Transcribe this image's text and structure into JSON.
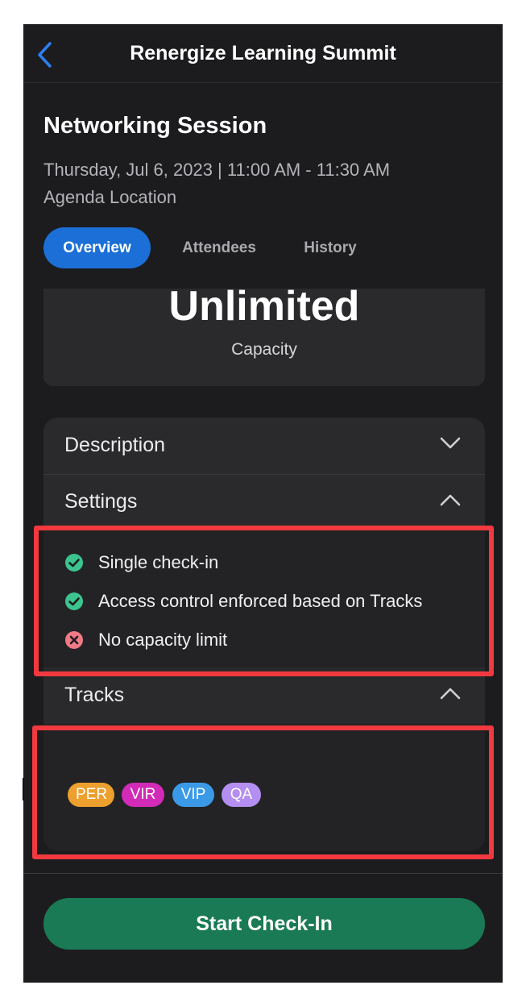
{
  "header": {
    "title": "Renergize Learning Summit",
    "back_icon": "chevron-left-icon",
    "accent": "#1b6fd6"
  },
  "session": {
    "title": "Networking Session",
    "date_time": "Thursday, Jul 6, 2023 | 11:00 AM - 11:30 AM",
    "location": "Agenda Location"
  },
  "tabs": [
    {
      "label": "Overview",
      "active": true
    },
    {
      "label": "Attendees",
      "active": false
    },
    {
      "label": "History",
      "active": false
    }
  ],
  "capacity": {
    "value": "Unlimited",
    "label": "Capacity"
  },
  "sections": {
    "description": {
      "label": "Description",
      "expanded": false
    },
    "settings": {
      "label": "Settings",
      "expanded": true,
      "items": [
        {
          "text": "Single check-in",
          "status": "enabled",
          "icon": "check-circle-icon",
          "color": "#3cc48f"
        },
        {
          "text": "Access control enforced based on Tracks",
          "status": "enabled",
          "icon": "check-circle-icon",
          "color": "#3cc48f"
        },
        {
          "text": "No capacity limit",
          "status": "disabled",
          "icon": "x-circle-icon",
          "color": "#f07a86"
        }
      ]
    },
    "tracks": {
      "label": "Tracks",
      "expanded": true,
      "items": [
        {
          "label": "PER",
          "color": "#eda02e"
        },
        {
          "label": "VIR",
          "color": "#d22bb8"
        },
        {
          "label": "VIP",
          "color": "#3b9ae8"
        },
        {
          "label": "QA",
          "color": "#b48ef0"
        }
      ]
    }
  },
  "footer": {
    "button_label": "Start Check-In",
    "button_color": "#1a7a55"
  },
  "highlight_color": "#f1393f"
}
